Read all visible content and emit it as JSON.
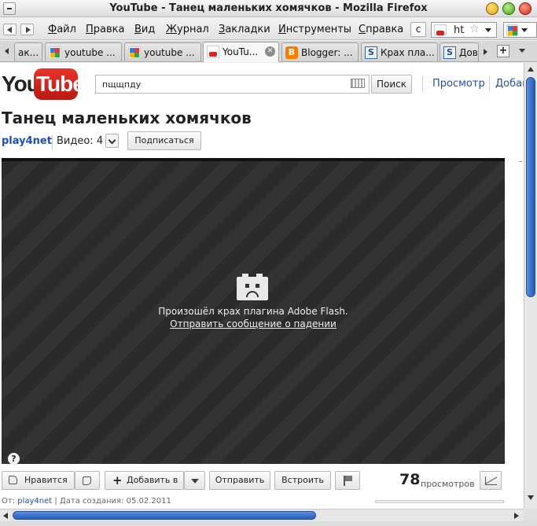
{
  "window": {
    "title": "YouTube - Танец маленьких хомячков - Mozilla Firefox"
  },
  "menubar": {
    "items": [
      "Файл",
      "Правка",
      "Вид",
      "Журнал",
      "Закладки",
      "Инструменты",
      "Справка"
    ],
    "url_text": "ht",
    "reload_glyph": "c"
  },
  "tabs": [
    {
      "label": "ак...",
      "icon": "page-icon"
    },
    {
      "label": "youtube ...",
      "icon": "google-icon"
    },
    {
      "label": "youtube ...",
      "icon": "google-icon"
    },
    {
      "label": "YouTu...",
      "icon": "youtube-icon",
      "active": true
    },
    {
      "label": "Blogger: ...",
      "icon": "blogger-icon"
    },
    {
      "label": "Крах пла...",
      "icon": "s-icon"
    },
    {
      "label": "Дов",
      "icon": "s-icon"
    }
  ],
  "site": {
    "logo_you": "You",
    "logo_tube": "Tube",
    "search_value": "пщщпду",
    "search_button": "Поиск",
    "link_browse": "Просмотр",
    "link_upload": "Добав"
  },
  "video": {
    "title": "Танец маленьких хомячков",
    "channel": "play4net",
    "videos_count": "Видео: 4",
    "subscribe": "Подписаться",
    "crash_message": "Произошёл крах плагина Adobe Flash.",
    "crash_link": "Отправить сообщение о падении",
    "help": "?"
  },
  "actions": {
    "like": "Нравится",
    "add_to": "Добавить в",
    "share": "Отправить",
    "embed": "Встроить",
    "views_count": "78",
    "views_label": "просмотров"
  },
  "meta": {
    "from_label": "От:",
    "author": "play4net",
    "date_text": "| Дата создания: 05.02.2011"
  },
  "colors": {
    "link": "#1c4fbd",
    "scroll_thumb": "#3a6fc8",
    "youtube_red": "#d3221b"
  }
}
